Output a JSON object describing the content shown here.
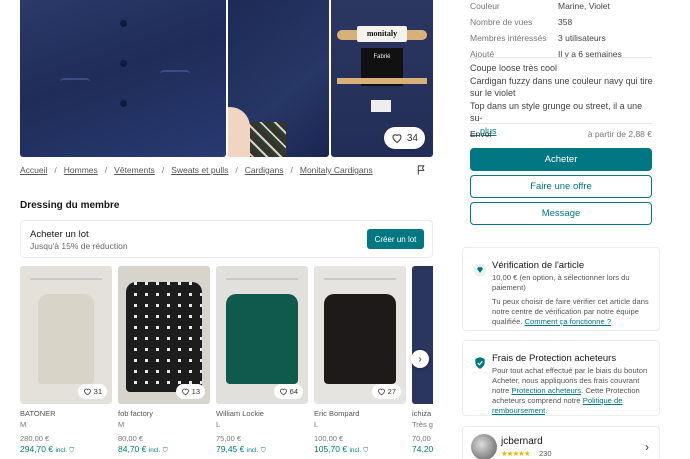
{
  "gallery": {
    "photo_3": {
      "label_brand": "monitaly",
      "label_made": "Fabrié",
      "fav_count": "34"
    }
  },
  "specs": [
    {
      "key": "Couleur",
      "value": "Marine, Violet"
    },
    {
      "key": "Nombre de vues",
      "value": "358"
    },
    {
      "key": "Membres intéressés",
      "value": "3 utilisateurs"
    },
    {
      "key": "Ajouté",
      "value": "Il y a 6 semaines"
    }
  ],
  "description": {
    "title": "Coupe loose très cool",
    "line1": "Cardigan fuzzy dans une couleur navy qui tire sur le violet",
    "line2": "Top dans un style grunge ou street, il a une su-",
    "more": "... plus"
  },
  "shipping": {
    "label": "Envoi",
    "value": "à partir de 2,88 €"
  },
  "actions": {
    "buy": "Acheter",
    "offer": "Faire une offre",
    "message": "Message"
  },
  "verification": {
    "title": "Vérification de l'article",
    "body1": "10,00 € (en option, à sélectionner lors du paiement)",
    "body2": "Tu peux choisir de faire vérifier cet article dans notre centre de vérification par notre équipe qualifiée.",
    "link": "Comment ça fonctionne ?"
  },
  "protection": {
    "title": "Frais de Protection acheteurs",
    "body1": "Pour tout achat effectué par le biais du bouton Acheter, nous appliquons des frais couvrant notre",
    "link1": "Protection acheteurs",
    "body2": ". Cette Protection acheteurs comprend notre",
    "link2": "Politique de remboursement",
    "body3": "."
  },
  "seller": {
    "name": "jcbernard",
    "stars": "★★★★★",
    "reviews": "230"
  },
  "breadcrumb": [
    "Accueil",
    "Hommes",
    "Vêtements",
    "Sweats et pulls",
    "Cardigans",
    "Monitaly Cardigans"
  ],
  "dressing": {
    "title": "Dressing du membre",
    "bundle_title": "Acheter un lot",
    "bundle_sub": "Jusqu'à 15% de réduction",
    "bundle_button": "Créer un lot"
  },
  "items": [
    {
      "brand": "BATONER",
      "size": "M",
      "price": "280,00 €",
      "price_incl": "294,70 €",
      "incl": "incl.",
      "favs": "31",
      "color": "#d9d4c8"
    },
    {
      "brand": "fob factory",
      "size": "M",
      "price": "80,00 €",
      "price_incl": "84,70 €",
      "incl": "incl.",
      "favs": "13",
      "color": "#2a2a2a"
    },
    {
      "brand": "William Lockie",
      "size": "L",
      "price": "75,00 €",
      "price_incl": "79,45 €",
      "incl": "incl.",
      "favs": "64",
      "color": "#0f5a4c"
    },
    {
      "brand": "Eric Bompard",
      "size": "L",
      "price": "100,00 €",
      "price_incl": "105,70 €",
      "incl": "incl.",
      "favs": "27",
      "color": "#1e1a19"
    },
    {
      "brand": "ichiza",
      "size": "Très g",
      "price": "70,00",
      "price_incl": "74,20",
      "incl": "",
      "favs": "",
      "color": "#2a3560"
    }
  ],
  "colors": {
    "accent": "#007782",
    "stars": "#f0b400"
  }
}
